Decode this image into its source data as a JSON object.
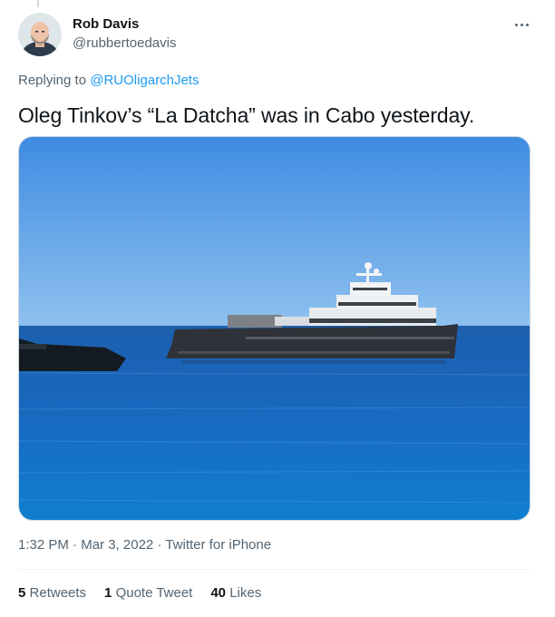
{
  "tweet": {
    "author_name": "Rob Davis",
    "author_handle": "@rubbertoedavis",
    "replying_prefix": "Replying to",
    "replying_handle": "@RUOligarchJets",
    "text": "Oleg Tinkov’s “La Datcha” was in Cabo yesterday.",
    "time": "1:32 PM",
    "date": "Mar 3, 2022",
    "source": "Twitter for iPhone",
    "separator": "·"
  },
  "stats": [
    {
      "count": "5",
      "label": "Retweets"
    },
    {
      "count": "1",
      "label": "Quote Tweet"
    },
    {
      "count": "40",
      "label": "Likes"
    }
  ],
  "icons": {
    "more": "more-horizontal-icon",
    "avatar": "avatar-photo"
  },
  "colors": {
    "link": "#1d9bf0",
    "secondary_text": "#536471",
    "primary_text": "#0f1419",
    "sky": "#4b93df",
    "sea": "#1560b8"
  }
}
